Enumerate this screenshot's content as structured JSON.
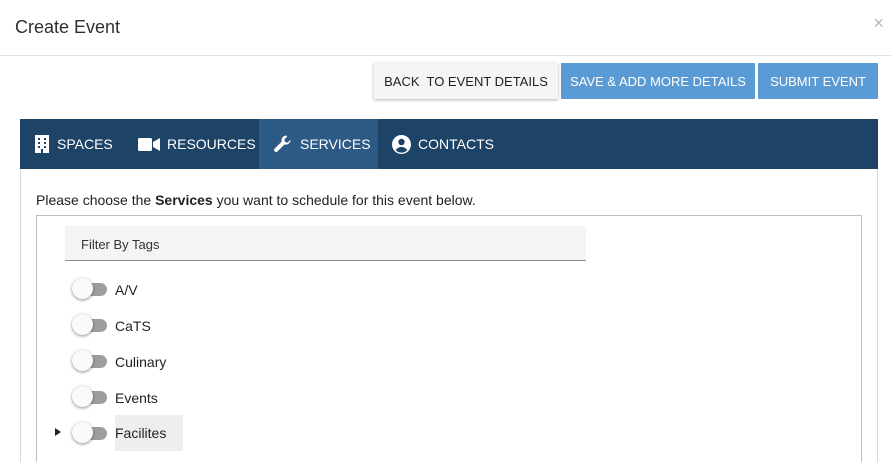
{
  "dialog": {
    "title": "Create Event",
    "close_glyph": "×"
  },
  "actions": {
    "back_label": "BACK  TO EVENT DETAILS",
    "save_label": "SAVE & ADD MORE DETAILS",
    "submit_label": "SUBMIT EVENT"
  },
  "tabs": [
    {
      "label": "SPACES",
      "icon": "building-icon"
    },
    {
      "label": "RESOURCES",
      "icon": "video-camera-icon"
    },
    {
      "label": "SERVICES",
      "icon": "wrench-icon",
      "active": true
    },
    {
      "label": "CONTACTS",
      "icon": "user-circle-icon"
    }
  ],
  "services": {
    "instruction_prefix": "Please choose the ",
    "instruction_bold": "Services",
    "instruction_suffix": " you want to schedule for this event below.",
    "filter_label": "Filter By Tags",
    "tags": [
      {
        "label": "A/V",
        "on": false
      },
      {
        "label": "CaTS",
        "on": false
      },
      {
        "label": "Culinary",
        "on": false
      },
      {
        "label": "Events",
        "on": false
      },
      {
        "label": "Facilites",
        "on": false,
        "expandable": true,
        "highlighted": true
      }
    ]
  },
  "colors": {
    "tab_bar": "#1d4466",
    "tab_active": "#2c5a85",
    "primary_button": "#5b9bd5"
  }
}
